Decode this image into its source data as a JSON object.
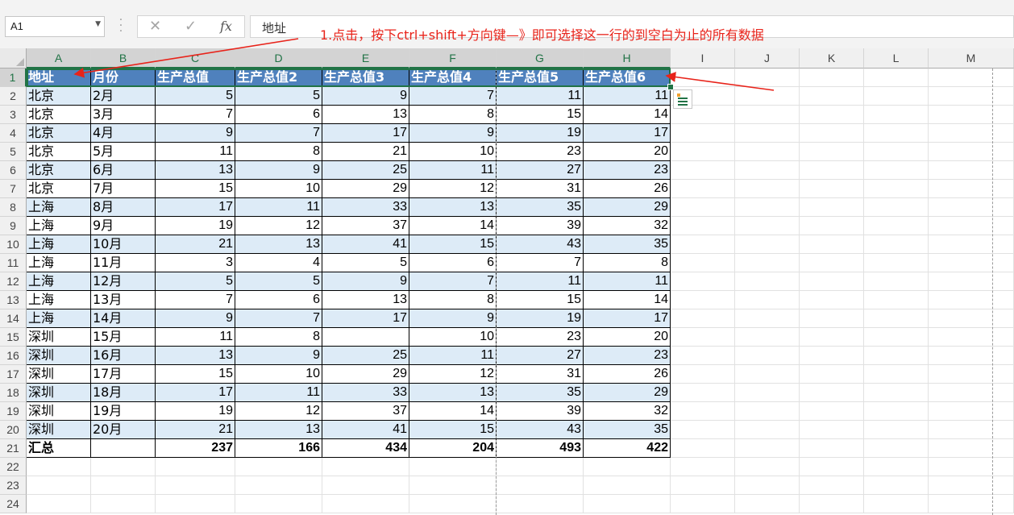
{
  "name_box": {
    "value": "A1"
  },
  "formula_bar": {
    "cancel_glyph": "✕",
    "enter_glyph": "✓",
    "fx_label": "fx",
    "content": "地址"
  },
  "annotation": {
    "text": "1.点击，按下ctrl+shift+方向键—》即可选择这一行的到空白为止的所有数据",
    "color": "#e8231a"
  },
  "columns": [
    "A",
    "B",
    "C",
    "D",
    "E",
    "F",
    "G",
    "H",
    "I",
    "J",
    "K",
    "L",
    "M"
  ],
  "rows": [
    "1",
    "2",
    "3",
    "4",
    "5",
    "6",
    "7",
    "8",
    "9",
    "10",
    "11",
    "12",
    "13",
    "14",
    "15",
    "16",
    "17",
    "18",
    "19",
    "20",
    "21",
    "22",
    "23",
    "24"
  ],
  "selected_cell": "A1",
  "colors": {
    "header_fill": "#4f81bd",
    "band_fill": "#ddebf7",
    "selection": "#217346"
  },
  "table": {
    "headers": [
      "地址",
      "月份",
      "生产总值",
      "生产总值2",
      "生产总值3",
      "生产总值4",
      "生产总值5",
      "生产总值6"
    ],
    "rows": [
      [
        "北京",
        "2月",
        "5",
        "5",
        "9",
        "7",
        "11",
        "11"
      ],
      [
        "北京",
        "3月",
        "7",
        "6",
        "13",
        "8",
        "15",
        "14"
      ],
      [
        "北京",
        "4月",
        "9",
        "7",
        "17",
        "9",
        "19",
        "17"
      ],
      [
        "北京",
        "5月",
        "11",
        "8",
        "21",
        "10",
        "23",
        "20"
      ],
      [
        "北京",
        "6月",
        "13",
        "9",
        "25",
        "11",
        "27",
        "23"
      ],
      [
        "北京",
        "7月",
        "15",
        "10",
        "29",
        "12",
        "31",
        "26"
      ],
      [
        "上海",
        "8月",
        "17",
        "11",
        "33",
        "13",
        "35",
        "29"
      ],
      [
        "上海",
        "9月",
        "19",
        "12",
        "37",
        "14",
        "39",
        "32"
      ],
      [
        "上海",
        "10月",
        "21",
        "13",
        "41",
        "15",
        "43",
        "35"
      ],
      [
        "上海",
        "11月",
        "3",
        "4",
        "5",
        "6",
        "7",
        "8"
      ],
      [
        "上海",
        "12月",
        "5",
        "5",
        "9",
        "7",
        "11",
        "11"
      ],
      [
        "上海",
        "13月",
        "7",
        "6",
        "13",
        "8",
        "15",
        "14"
      ],
      [
        "上海",
        "14月",
        "9",
        "7",
        "17",
        "9",
        "19",
        "17"
      ],
      [
        "深圳",
        "15月",
        "11",
        "8",
        "",
        "10",
        "23",
        "20"
      ],
      [
        "深圳",
        "16月",
        "13",
        "9",
        "25",
        "11",
        "27",
        "23"
      ],
      [
        "深圳",
        "17月",
        "15",
        "10",
        "29",
        "12",
        "31",
        "26"
      ],
      [
        "深圳",
        "18月",
        "17",
        "11",
        "33",
        "13",
        "35",
        "29"
      ],
      [
        "深圳",
        "19月",
        "19",
        "12",
        "37",
        "14",
        "39",
        "32"
      ],
      [
        "深圳",
        "20月",
        "21",
        "13",
        "41",
        "15",
        "43",
        "35"
      ]
    ],
    "total_row": [
      "汇总",
      "",
      "237",
      "166",
      "434",
      "204",
      "493",
      "422"
    ]
  }
}
